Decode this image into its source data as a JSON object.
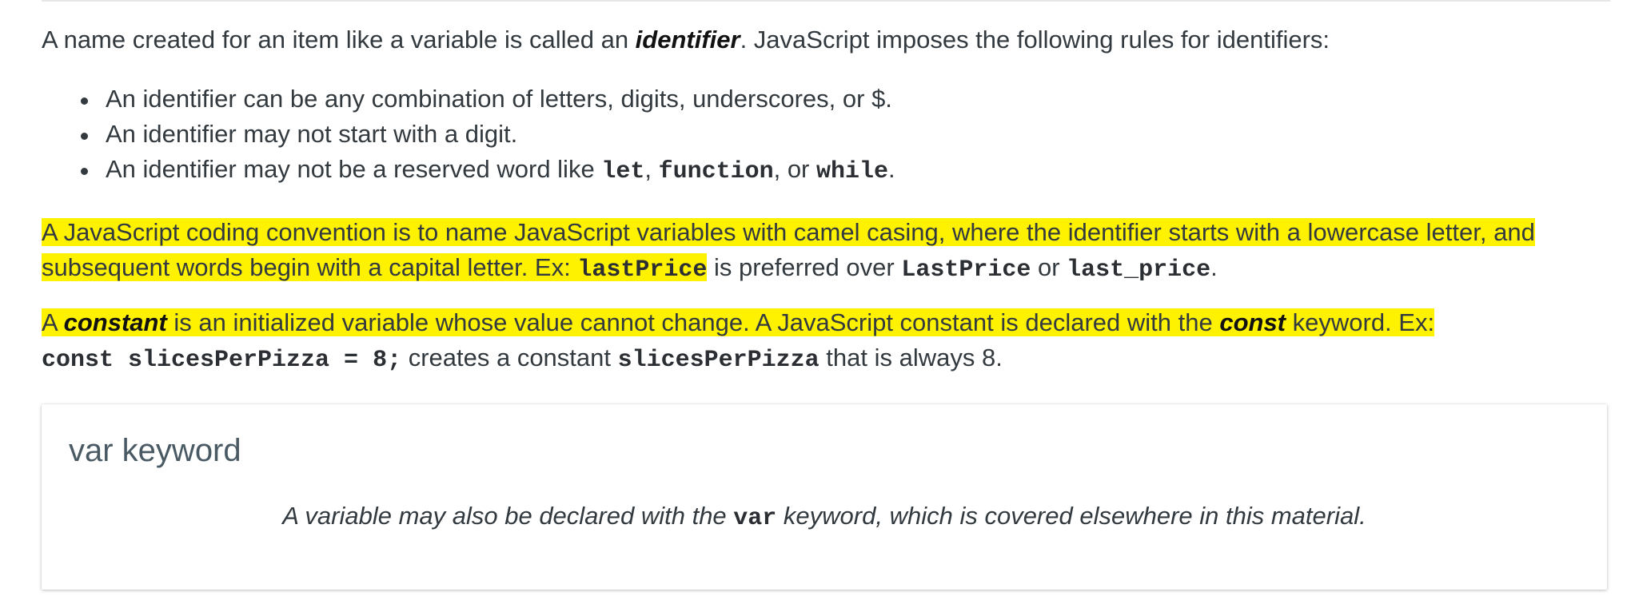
{
  "intro": {
    "before": "A name created for an item like a variable is called an ",
    "term": "identifier",
    "after": ". JavaScript imposes the following rules for identifiers:"
  },
  "rules": [
    "An identifier can be any combination of letters, digits, underscores, or $.",
    "An identifier may not start with a digit.",
    {
      "before": "An identifier may not be a reserved word like ",
      "word1": "let",
      "sep1": ", ",
      "word2": "function",
      "sep2": ", or ",
      "word3": "while",
      "after": "."
    }
  ],
  "camel": {
    "highlighted_text": "A JavaScript coding convention is to name JavaScript variables with camel casing, where the identifier starts with a lowercase letter, and subsequent words begin with a capital letter. Ex: ",
    "example_good": "lastPrice",
    "mid": " is preferred over ",
    "example_bad1": "LastPrice",
    "or": " or ",
    "example_bad2": "last_price",
    "end": "."
  },
  "constant": {
    "a": "A ",
    "term": "constant",
    "text1": " is an initialized variable whose value cannot change. A JavaScript constant is declared with the ",
    "keyword": "const",
    "text2": " keyword. Ex:",
    "code": "const slicesPerPizza = 8;",
    "text3": " creates a constant ",
    "code2": "slicesPerPizza",
    "text4": " that is always 8."
  },
  "panel": {
    "title": "var keyword",
    "body_before": "A variable may also be declared with the ",
    "body_code": "var",
    "body_after": " keyword, which is covered elsewhere in this material."
  }
}
